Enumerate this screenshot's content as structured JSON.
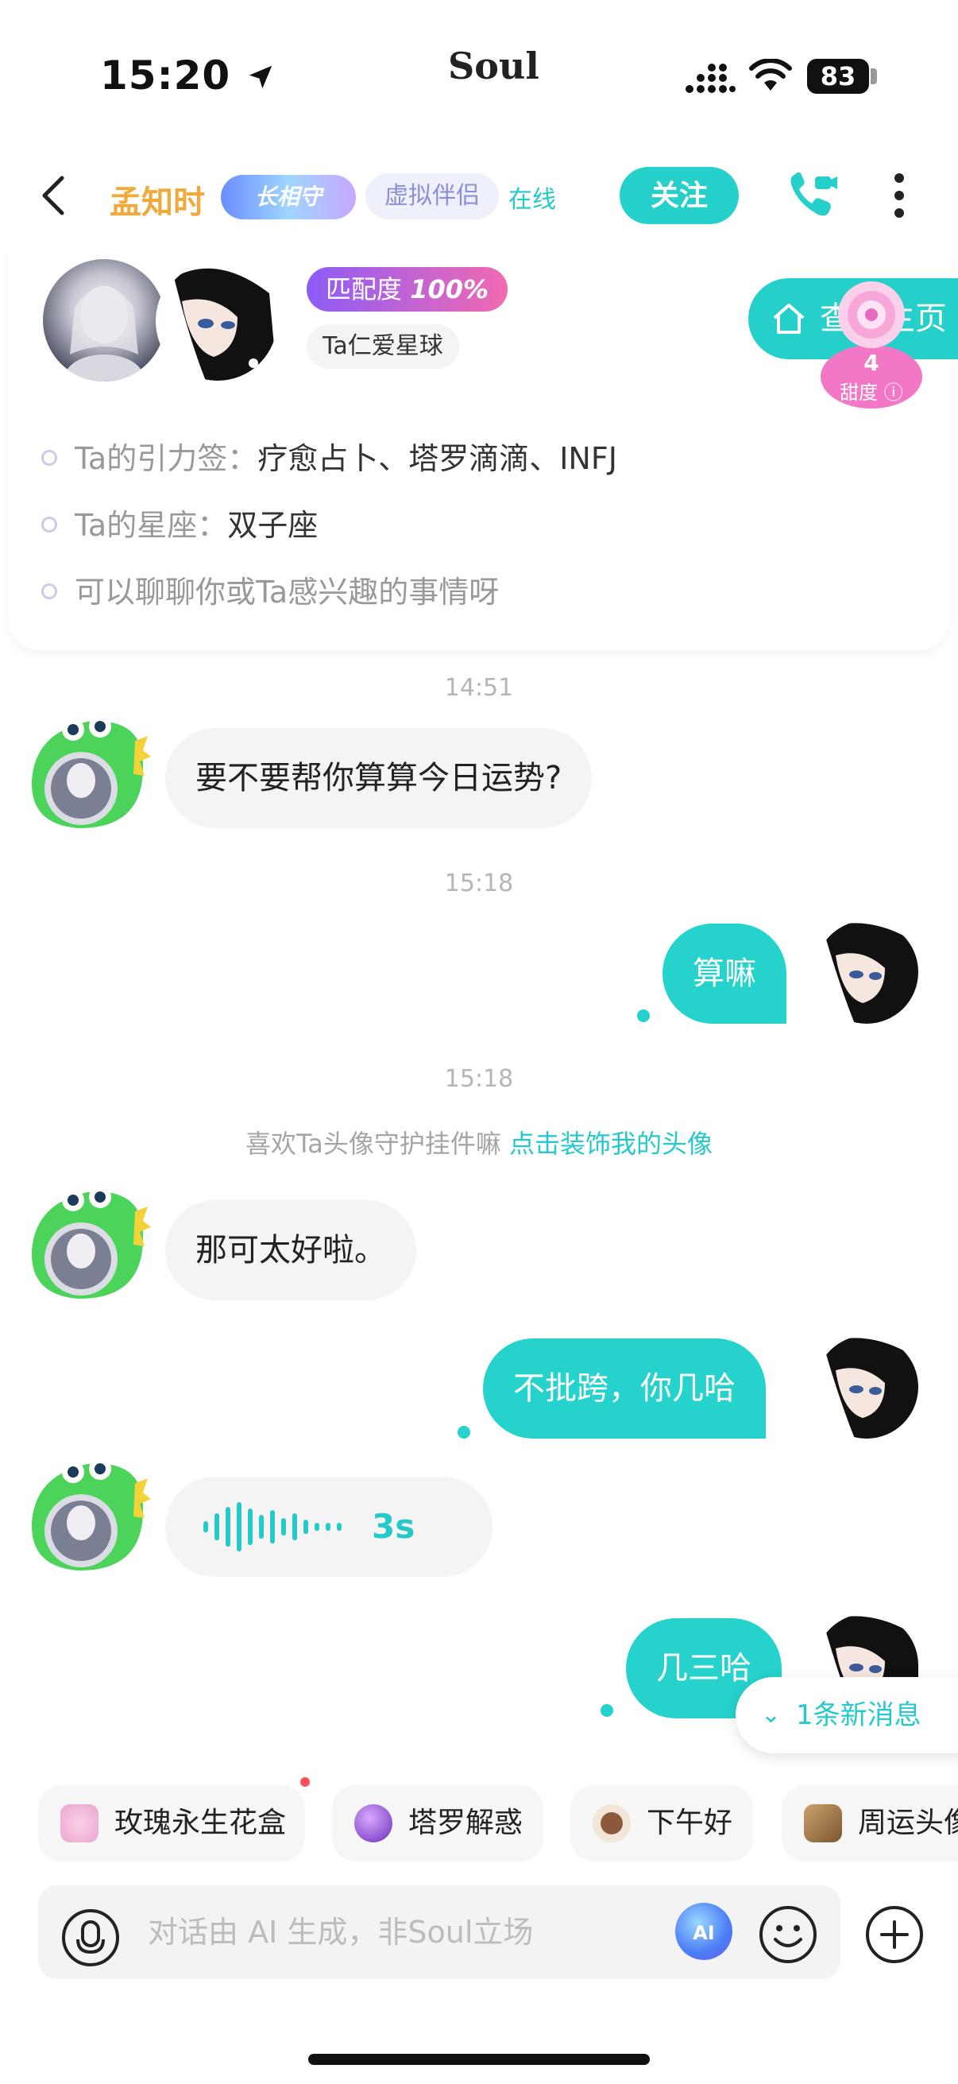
{
  "status_bar": {
    "time": "15:20",
    "app_logo": "Soul",
    "battery": "83"
  },
  "header": {
    "nickname": "孟知时",
    "medal": "长相守",
    "virtual_tag": "虚拟伴侣",
    "online": "在线",
    "follow": "关注"
  },
  "profile": {
    "match_label": "匹配度",
    "match_value": "100%",
    "planet": "Ta仁爱星球",
    "view_home": "查看主页",
    "sweet_value": "4",
    "sweet_label": "甜度",
    "info": [
      {
        "label": "Ta的引力签：",
        "value": "疗愈占卜、塔罗滴滴、INFJ"
      },
      {
        "label": "Ta的星座：",
        "value": "双子座"
      },
      {
        "label": "可以聊聊你或Ta感兴趣的事情呀",
        "value": ""
      }
    ]
  },
  "chat": {
    "ts1": "14:51",
    "msg1": "要不要帮你算算今日运势?",
    "ts2": "15:18",
    "msg2": "算嘛",
    "ts3": "15:18",
    "hint_text": "喜欢Ta头像守护挂件嘛 ",
    "hint_link": "点击装饰我的头像",
    "msg3": "那可太好啦。",
    "msg4": "不批跨，你几哈",
    "voice_duration": "3s",
    "msg5": "几三哈",
    "new_messages": "1条新消息"
  },
  "quick_chips": [
    {
      "label": "玫瑰永生花盒",
      "icon": "rose-gift-icon"
    },
    {
      "label": "塔罗解惑",
      "icon": "crystal-ball-icon"
    },
    {
      "label": "下午好",
      "icon": "coffee-cup-icon"
    },
    {
      "label": "周运头像",
      "icon": "tarot-card-icon"
    }
  ],
  "input": {
    "placeholder": "对话由 AI 生成，非Soul立场"
  },
  "colors": {
    "accent": "#25cfca",
    "nickname": "#f2a93b",
    "incoming_bubble": "#f4f4f5"
  }
}
